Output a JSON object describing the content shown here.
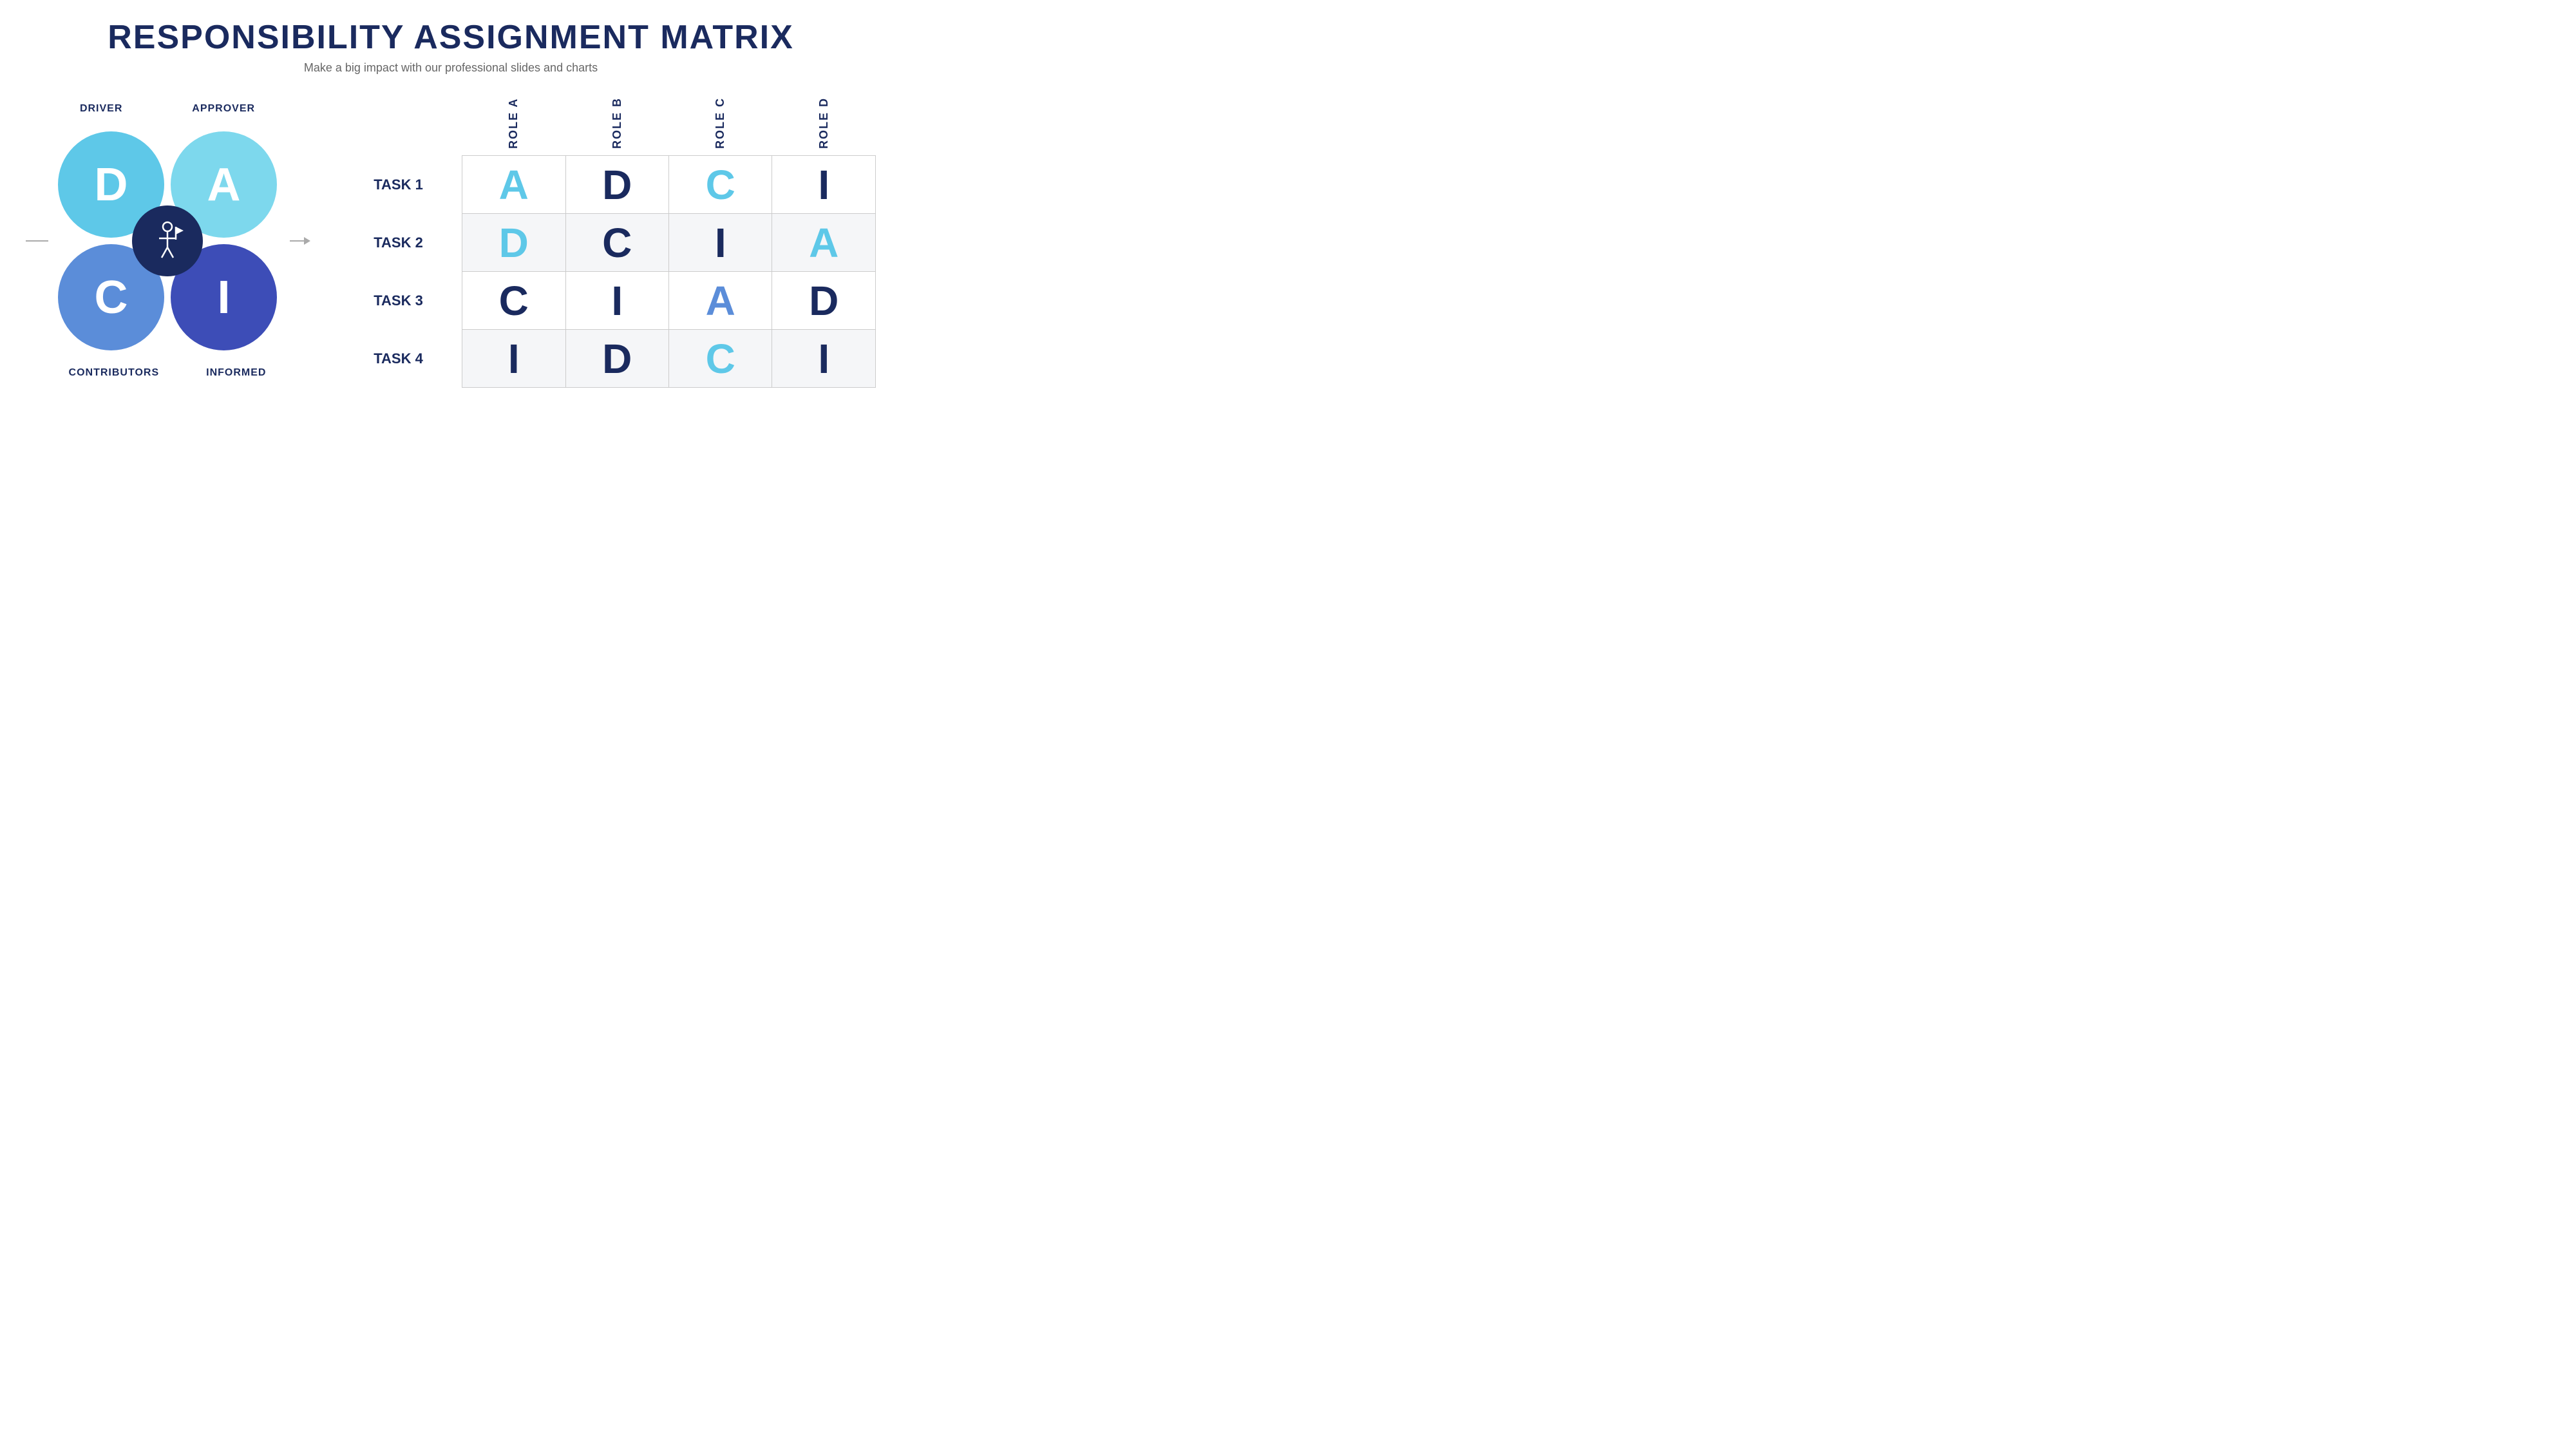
{
  "header": {
    "title": "RESPONSIBILITY ASSIGNMENT MATRIX",
    "subtitle": "Make a big impact with our professional slides and charts"
  },
  "diagram": {
    "circles": [
      {
        "id": "d",
        "label": "D",
        "role_label": "DRIVER",
        "position": "top-left"
      },
      {
        "id": "a",
        "label": "A",
        "role_label": "APPROVER",
        "position": "top-right"
      },
      {
        "id": "c",
        "label": "C",
        "role_label": "CONTRIBUTORS",
        "position": "bottom-left"
      },
      {
        "id": "i",
        "label": "I",
        "role_label": "INFORMED",
        "position": "bottom-right"
      }
    ]
  },
  "matrix": {
    "roles": [
      "ROLE A",
      "ROLE B",
      "ROLE C",
      "ROLE D"
    ],
    "tasks": [
      {
        "name": "TASK 1",
        "values": [
          {
            "letter": "A",
            "color": "cyan"
          },
          {
            "letter": "D",
            "color": "navy"
          },
          {
            "letter": "C",
            "color": "cyan"
          },
          {
            "letter": "I",
            "color": "navy"
          }
        ]
      },
      {
        "name": "TASK 2",
        "values": [
          {
            "letter": "D",
            "color": "cyan"
          },
          {
            "letter": "C",
            "color": "navy"
          },
          {
            "letter": "I",
            "color": "navy"
          },
          {
            "letter": "A",
            "color": "cyan"
          }
        ]
      },
      {
        "name": "TASK 3",
        "values": [
          {
            "letter": "C",
            "color": "navy"
          },
          {
            "letter": "I",
            "color": "navy"
          },
          {
            "letter": "A",
            "color": "blue"
          },
          {
            "letter": "D",
            "color": "navy"
          }
        ]
      },
      {
        "name": "TASK 4",
        "values": [
          {
            "letter": "I",
            "color": "navy"
          },
          {
            "letter": "D",
            "color": "navy"
          },
          {
            "letter": "C",
            "color": "cyan"
          },
          {
            "letter": "I",
            "color": "navy"
          }
        ]
      }
    ]
  }
}
